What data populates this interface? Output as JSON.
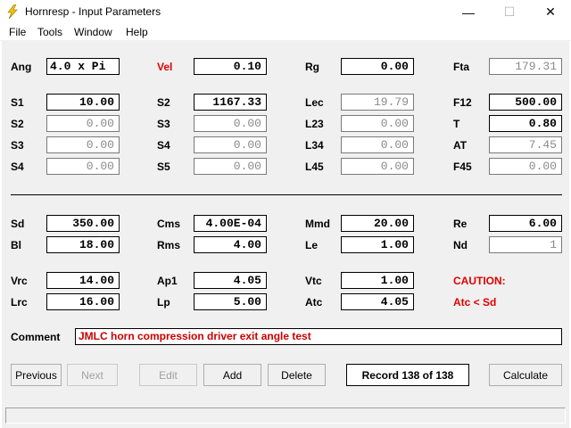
{
  "window": {
    "title": "Hornresp - Input Parameters",
    "minimize": "—",
    "maximize": "☐",
    "close": "✕",
    "icon": "lightning-bolt-icon",
    "icon_color": "#f5c400"
  },
  "menu": {
    "file": "File",
    "tools": "Tools",
    "window": "Window",
    "help": "Help"
  },
  "params": {
    "ang_label": "Ang",
    "ang": "4.0 x Pi",
    "vel_label": "Vel",
    "vel": "0.10",
    "rg_label": "Rg",
    "rg": "0.00",
    "fta_label": "Fta",
    "fta": "179.31",
    "s1_label": "S1",
    "s1": "10.00",
    "s2b_label": "S2",
    "s2b": "1167.33",
    "lec_label": "Lec",
    "lec": "19.79",
    "f12_label": "F12",
    "f12": "500.00",
    "s2_label": "S2",
    "s2": "0.00",
    "s3b_label": "S3",
    "s3b": "0.00",
    "l23_label": "L23",
    "l23": "0.00",
    "t_label": "T",
    "t": "0.80",
    "s3_label": "S3",
    "s3": "0.00",
    "s4b_label": "S4",
    "s4b": "0.00",
    "l34_label": "L34",
    "l34": "0.00",
    "at_label": "AT",
    "at": "7.45",
    "s4_label": "S4",
    "s4": "0.00",
    "s5_label": "S5",
    "s5": "0.00",
    "l45_label": "L45",
    "l45": "0.00",
    "f45_label": "F45",
    "f45": "0.00"
  },
  "driver": {
    "sd_label": "Sd",
    "sd": "350.00",
    "cms_label": "Cms",
    "cms": "4.00E-04",
    "mmd_label": "Mmd",
    "mmd": "20.00",
    "re_label": "Re",
    "re": "6.00",
    "bl_label": "Bl",
    "bl": "18.00",
    "rms_label": "Rms",
    "rms": "4.00",
    "le_label": "Le",
    "le": "1.00",
    "nd_label": "Nd",
    "nd": "1",
    "vrc_label": "Vrc",
    "vrc": "14.00",
    "ap1_label": "Ap1",
    "ap1": "4.05",
    "vtc_label": "Vtc",
    "vtc": "1.00",
    "caution_label": "CAUTION:",
    "lrc_label": "Lrc",
    "lrc": "16.00",
    "lp_label": "Lp",
    "lp": "5.00",
    "atc_label": "Atc",
    "atc": "4.05",
    "caution_msg": "Atc < Sd"
  },
  "comment": {
    "label": "Comment",
    "value": "JMLC horn compression driver exit angle test"
  },
  "buttons": {
    "previous": "Previous",
    "next": "Next",
    "edit": "Edit",
    "add": "Add",
    "delete": "Delete",
    "record": "Record 138 of 138",
    "calculate": "Calculate"
  }
}
